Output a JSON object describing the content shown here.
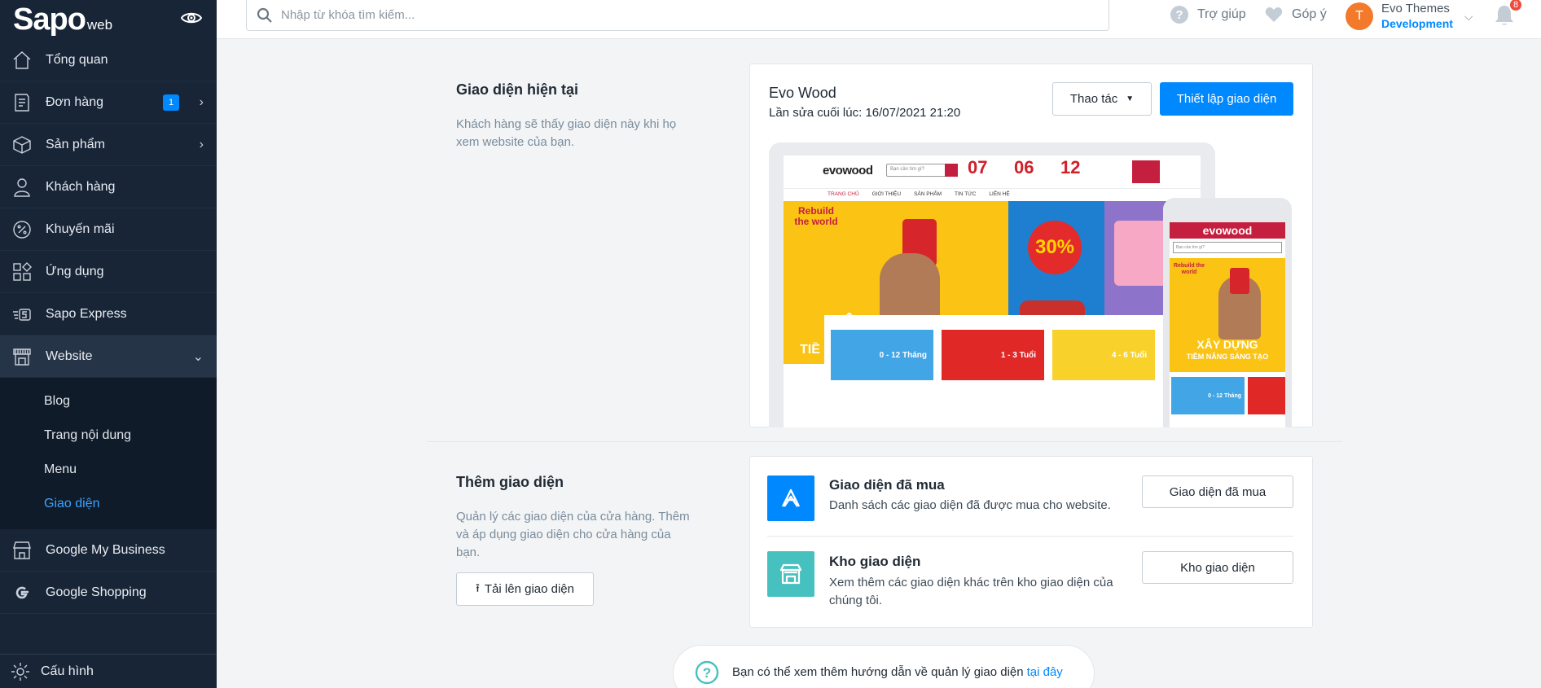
{
  "sidebar": {
    "logo": "Sapo",
    "logo_suffix": "web",
    "items": [
      {
        "label": "Tổng quan"
      },
      {
        "label": "Đơn hàng",
        "badge": "1"
      },
      {
        "label": "Sản phẩm"
      },
      {
        "label": "Khách hàng"
      },
      {
        "label": "Khuyến mãi"
      },
      {
        "label": "Ứng dụng"
      },
      {
        "label": "Sapo Express"
      },
      {
        "label": "Website"
      },
      {
        "label": "Google My Business"
      },
      {
        "label": "Google Shopping"
      }
    ],
    "website_sub": [
      "Blog",
      "Trang nội dung",
      "Menu",
      "Giao diện"
    ],
    "config_label": "Cấu hình"
  },
  "topbar": {
    "search_placeholder": "Nhập từ khóa tìm kiếm...",
    "help_label": "Trợ giúp",
    "feedback_label": "Góp ý",
    "avatar_letter": "T",
    "user_name": "Evo Themes",
    "user_role": "Development",
    "notification_count": "8"
  },
  "current_theme": {
    "section_title": "Giao diện hiện tại",
    "section_desc": "Khách hàng sẽ thấy giao diện này khi họ xem website của bạn.",
    "theme_name": "Evo Wood",
    "last_edited": "Lần sửa cuối lúc: 16/07/2021 21:20",
    "actions_label": "Thao tác",
    "setup_label": "Thiết lập giao diện"
  },
  "preview": {
    "brand": "evowood",
    "search_hint": "Bạn cần tìm gì?",
    "counters": [
      "07",
      "06",
      "12"
    ],
    "menu": [
      "TRANG CHỦ",
      "GIỚI THIỆU",
      "SẢN PHẨM",
      "TIN TỨC",
      "LIÊN HỆ"
    ],
    "hero_tag": "Rebuild the world",
    "hero_title": "XÂY DỰNG",
    "hero_sub": "TIỀM NĂNG SÁNG TẠO",
    "hero_left_cut": "TIỀ",
    "promo": "30%",
    "age_tiles": [
      "0 - 12 Tháng",
      "1 - 3 Tuổi",
      "4 - 6 Tuổi"
    ]
  },
  "add_theme": {
    "section_title": "Thêm giao diện",
    "section_desc": "Quản lý các giao diện của cửa hàng. Thêm và áp dụng giao diện cho cửa hàng của bạn.",
    "upload_label": "Tải lên giao diện",
    "purchased_title": "Giao diện đã mua",
    "purchased_desc": "Danh sách các giao diện đã được mua cho website.",
    "purchased_button": "Giao diện đã mua",
    "store_title": "Kho giao diện",
    "store_desc": "Xem thêm các giao diện khác trên kho giao diện của chúng tôi.",
    "store_button": "Kho giao diện",
    "purchased_color": "#0088ff",
    "store_color": "#47c1bf"
  },
  "help": {
    "text": "Bạn có thể xem thêm hướng dẫn về quản lý giao diện",
    "link": "tại đây"
  }
}
